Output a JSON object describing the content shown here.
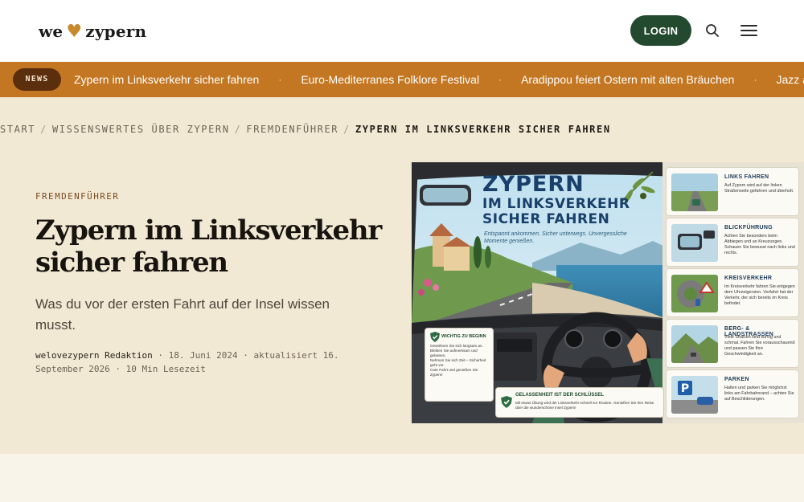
{
  "header": {
    "logo_left": "we",
    "logo_right": "zypern",
    "login_label": "LOGIN"
  },
  "ticker": {
    "badge": "NEWS",
    "items": [
      "Zypern im Linksverkehr sicher fahren",
      "Euro-Mediterranes Folklore Festival",
      "Aradippou feiert Ostern mit alten Bräuchen",
      "Jazz an"
    ],
    "separator": "·"
  },
  "breadcrumb": {
    "items": [
      "START",
      "WISSENSWERTES ÜBER ZYPERN",
      "FREMDENFÜHRER",
      "ZYPERN IM LINKSVERKEHR SICHER FAHREN"
    ],
    "separator": "/"
  },
  "article": {
    "category": "FREMDENFÜHRER",
    "title": "Zypern im Linksverkehr sicher fahren",
    "subtitle": "Was du vor der ersten Fahrt auf der Insel wissen musst.",
    "author": "welovezypern Redaktion",
    "meta": " · 18. Juni 2024 · aktualisiert 16. September 2026 · 10 Min Lesezeit"
  },
  "infographic": {
    "title_line1": "ZYPERN",
    "title_line2": "IM LINKSVERKEHR",
    "title_line3": "SICHER FAHREN",
    "tagline": "Entspannt ankommen. Sicher unterwegs. Unvergessliche Momente genießen.",
    "tips": [
      {
        "title": "LINKS FAHREN",
        "text": "Auf Zypern wird auf der linken Straßenseite gefahren und überholt."
      },
      {
        "title": "BLICKFÜHRUNG",
        "text": "Achten Sie besonders beim Abbiegen und an Kreuzungen. Schauen Sie bewusst nach links und rechts."
      },
      {
        "title": "KREISVERKEHR",
        "text": "Im Kreisverkehr fahren Sie entgegen dem Uhrzeigersinn. Vorfahrt hat der Verkehr, der sich bereits im Kreis befindet."
      },
      {
        "title": "BERG- & LANDSTRASSEN",
        "text": "Viele Straßen sind kurvig und schmal. Fahren Sie vorausschauend und passen Sie Ihre Geschwindigkeit an."
      },
      {
        "title": "PARKEN",
        "text": "Halten und parken Sie möglichst links am Fahrbahnrand – achten Sie auf Beschilderungen."
      }
    ],
    "begin_title": "WICHTIG ZU BEGINN",
    "begin_items": [
      "Gewöhnen Sie sich langsam an.",
      "Bleiben Sie aufmerksam und gelassen.",
      "Nehmen Sie sich Zeit – Sicherheit geht vor.",
      "Gute Fahrt und genießen Sie Zypern!"
    ],
    "calm_title": "GELASSENHEIT IST DER SCHLÜSSEL",
    "calm_text": "Mit etwas Übung wird der Linksverkehr schnell zur Routine. Genießen Sie Ihre Reise über die wunderschöne Insel Zypern!",
    "parking_letter": "P"
  },
  "colors": {
    "brand_green": "#234a2e",
    "ticker_bg": "#c47722",
    "badge_bg": "#5b2f0e",
    "hero_bg": "#f2e9d5",
    "heart": "#c8892a"
  }
}
